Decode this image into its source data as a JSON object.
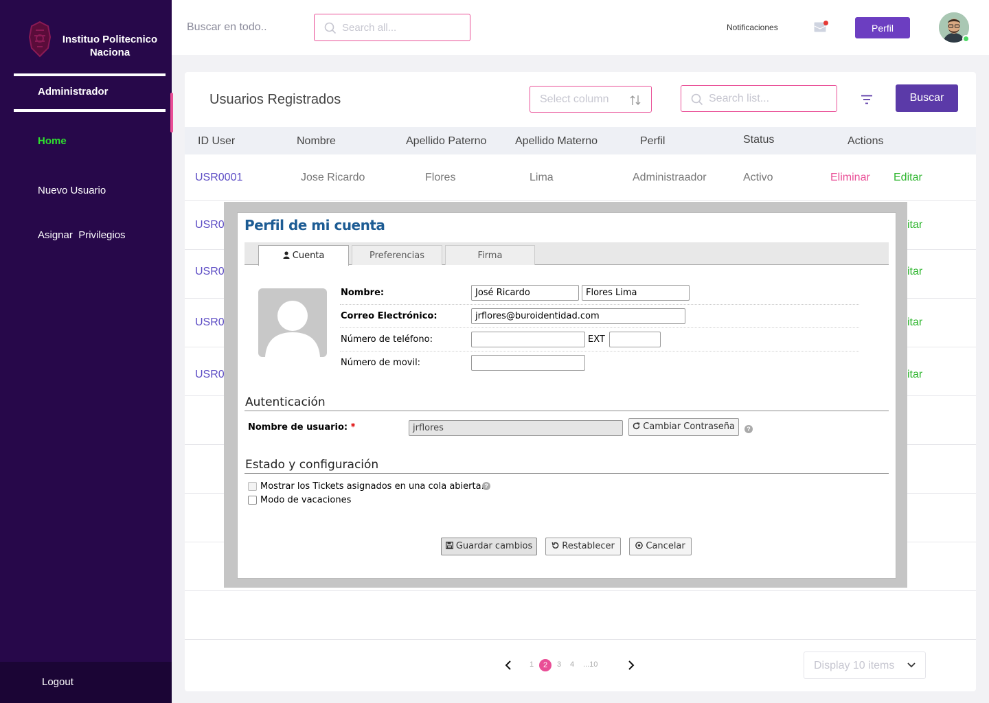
{
  "sidebar": {
    "brand": "Instituo Politecnico Naciona",
    "role": "Administrador",
    "items": [
      {
        "label": "Home",
        "active": true
      },
      {
        "label": "Nuevo Usuario"
      },
      {
        "label": "Asignar  Privilegios"
      }
    ],
    "logout": "Logout"
  },
  "topbar": {
    "search_label": "Buscar en todo..",
    "search_placeholder": "Search all...",
    "notifications": "Notificaciones",
    "profile_button": "Perfil"
  },
  "main": {
    "title": "Usuarios Registrados",
    "select_column_placeholder": "Select column",
    "search_list_placeholder": "Search list...",
    "search_button": "Buscar",
    "columns": [
      "ID User",
      "Nombre",
      "Apellido Paterno",
      "Apellido Materno",
      "Perfil",
      "Status",
      "Actions"
    ],
    "rows": [
      {
        "id": "USR0001",
        "nombre": "Jose Ricardo",
        "paterno": "Flores",
        "materno": "Lima",
        "perfil": "Administraador",
        "status": "Activo",
        "delete": "Eliminar",
        "edit": "Editar"
      },
      {
        "id": "USR00",
        "edit": "itar"
      },
      {
        "id": "USR00",
        "edit": "itar"
      },
      {
        "id": "USR00",
        "edit": "itar"
      },
      {
        "id": "USR00",
        "edit": "itar"
      }
    ],
    "pagination": {
      "pages": [
        "1",
        "2",
        "3",
        "4",
        "...10"
      ],
      "current": "2"
    },
    "display_items": "Display 10 items"
  },
  "modal": {
    "title": "Perfil de mi cuenta",
    "tabs": [
      "Cuenta",
      "Preferencias",
      "Firma"
    ],
    "active_tab": "Cuenta",
    "fields": {
      "nombre_label": "Nombre:",
      "first_name": "José Ricardo",
      "last_name": "Flores Lima",
      "email_label": "Correo Electrónico:",
      "email": "jrflores@buroidentidad.com",
      "phone_label": "Número de teléfono:",
      "phone": "",
      "ext_label": "EXT",
      "ext": "",
      "mobile_label": "Número de movil:",
      "mobile": ""
    },
    "auth": {
      "section": "Autenticación",
      "username_label": "Nombre de usuario:",
      "required_mark": "*",
      "username": "jrflores",
      "change_password": "Cambiar Contraseña"
    },
    "config": {
      "section": "Estado y configuración",
      "show_tickets": "Mostrar los Tickets asignados en una cola abierta.",
      "vacation": "Modo de vacaciones"
    },
    "actions": {
      "save": "Guardar cambios",
      "reset": "Restablecer",
      "cancel": "Cancelar"
    }
  },
  "colors": {
    "sidebar": "#27084a",
    "accent_pink": "#e94e96",
    "accent_purple": "#5b3aa8",
    "active_green": "#2ee02e",
    "modal_title": "#1d5c94"
  }
}
